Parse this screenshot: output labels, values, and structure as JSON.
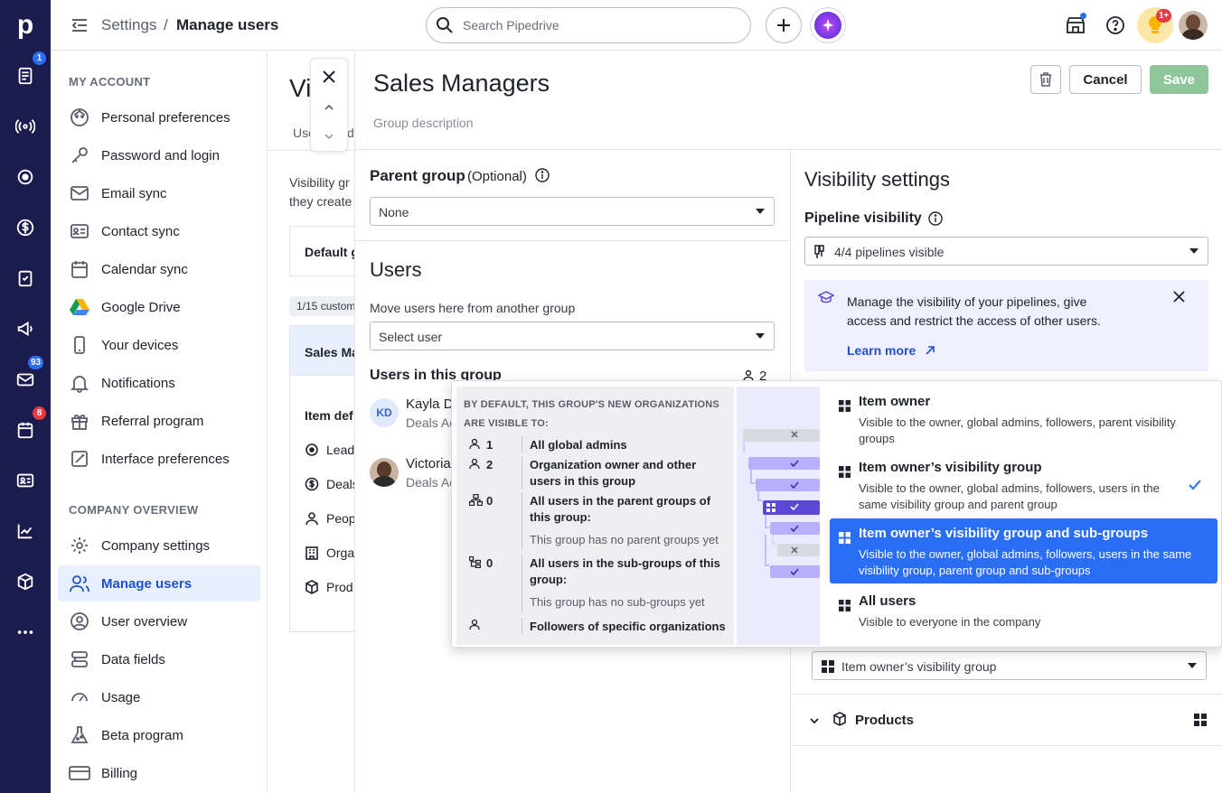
{
  "rail": {
    "logo": "p",
    "badges": {
      "leads": "1",
      "inbox": "93",
      "activities": "8"
    }
  },
  "topbar": {
    "breadcrumb_root": "Settings",
    "breadcrumb_sep": "/",
    "breadcrumb_current": "Manage users",
    "search_placeholder": "Search Pipedrive",
    "notif_badge": "1+"
  },
  "sidebar": {
    "my_account_title": "MY ACCOUNT",
    "my_account_items": [
      {
        "label": "Personal preferences"
      },
      {
        "label": "Password and login"
      },
      {
        "label": "Email sync"
      },
      {
        "label": "Contact sync"
      },
      {
        "label": "Calendar sync"
      },
      {
        "label": "Google Drive"
      },
      {
        "label": "Your devices"
      },
      {
        "label": "Notifications"
      },
      {
        "label": "Referral program"
      },
      {
        "label": "Interface preferences"
      }
    ],
    "company_title": "COMPANY OVERVIEW",
    "company_items": [
      {
        "label": "Company settings"
      },
      {
        "label": "Manage users"
      },
      {
        "label": "User overview"
      },
      {
        "label": "Data fields"
      },
      {
        "label": "Usage"
      },
      {
        "label": "Beta program"
      },
      {
        "label": "Billing"
      }
    ]
  },
  "background": {
    "title": "Vi",
    "tab1": "Use",
    "tab2": "d",
    "desc_line1": "Visibility gr",
    "desc_line2": "they create",
    "default_group": "Default g",
    "custom_count": "1/15 custom",
    "sales_card": "Sales Ma",
    "item_defaults": "Item def",
    "entities": [
      "Lead",
      "Deals",
      "Peop",
      "Orga",
      "Prod"
    ]
  },
  "drawer": {
    "group_name": "Sales Managers",
    "group_desc_placeholder": "Group description",
    "cancel_label": "Cancel",
    "save_label": "Save",
    "parent_group_label": "Parent group",
    "parent_group_optional": "(Optional)",
    "parent_group_value": "None",
    "users_title": "Users",
    "move_users_label": "Move users here from another group",
    "select_user_placeholder": "Select user",
    "users_in_group_label": "Users in this group",
    "users_count": "2",
    "users": [
      {
        "initials": "KD",
        "name": "Kayla D",
        "role": "Deals Ad"
      },
      {
        "initials": "",
        "name": "Victoria",
        "role": "Deals Ad"
      }
    ],
    "visibility_title": "Visibility settings",
    "pipeline_visibility_label": "Pipeline visibility",
    "pipeline_visibility_value": "4/4 pipelines visible",
    "info_text": "Manage the visibility of your pipelines, give access and restrict the access of other users.",
    "learn_more": "Learn more",
    "orgs_select_value": "Item owner’s visibility group",
    "products_label": "Products"
  },
  "popover": {
    "header": "BY DEFAULT, THIS GROUP'S NEW ORGANIZATIONS ARE VISIBLE TO:",
    "rows": [
      {
        "count": "1",
        "text": "All global admins",
        "sub": ""
      },
      {
        "count": "2",
        "text": "Organization owner and other users in this group",
        "sub": ""
      },
      {
        "count": "0",
        "text": "All users in the parent groups of this group:",
        "sub": "This group has no parent groups yet"
      },
      {
        "count": "0",
        "text": "All users in the sub-groups of this group:",
        "sub": "This group has no sub-groups yet"
      },
      {
        "count": "",
        "text": "Followers of specific organizations",
        "sub": ""
      }
    ],
    "options": [
      {
        "title": "Item owner",
        "desc": "Visible to the owner, global admins, followers, parent visibility groups",
        "selected": false,
        "checked": false
      },
      {
        "title": "Item owner’s visibility group",
        "desc": "Visible to the owner, global admins, followers, users in the same visibility group and parent group",
        "selected": false,
        "checked": true
      },
      {
        "title": "Item owner’s visibility group and sub-groups",
        "desc": "Visible to the owner, global admins, followers, users in the same visibility group, parent group and sub-groups",
        "selected": true,
        "checked": false
      },
      {
        "title": "All users",
        "desc": "Visible to everyone in the company",
        "selected": false,
        "checked": false
      }
    ]
  },
  "colors": {
    "rail": "#1b1c4e",
    "accent": "#2a6ef5",
    "save": "#8ec59a",
    "active_bg": "#e8f0fe"
  }
}
